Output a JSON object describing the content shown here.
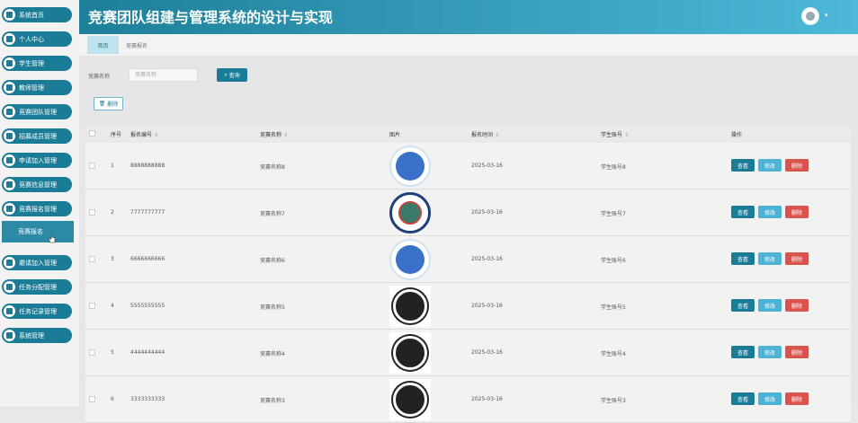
{
  "app": {
    "title": "竞赛团队组建与管理系统的设计与实现"
  },
  "sidebar": {
    "items": [
      {
        "label": "系统首页",
        "icon": "home-icon"
      },
      {
        "label": "个人中心",
        "icon": "user-center-icon"
      },
      {
        "label": "学生管理",
        "icon": "rocket-icon"
      },
      {
        "label": "教师管理",
        "icon": "grid-icon"
      },
      {
        "label": "竞赛团队管理",
        "icon": "grid-icon"
      },
      {
        "label": "招募成员管理",
        "icon": "grid-icon"
      },
      {
        "label": "申请加入管理",
        "icon": "grid-icon"
      },
      {
        "label": "竞赛信息管理",
        "icon": "grid-icon"
      },
      {
        "label": "竞赛报名管理",
        "icon": "person-icon"
      },
      {
        "label": "邀请加入管理",
        "icon": "list-icon"
      },
      {
        "label": "任务分配管理",
        "icon": "grid-icon"
      },
      {
        "label": "任务记录管理",
        "icon": "grid-icon"
      },
      {
        "label": "系统管理",
        "icon": "gear-icon"
      }
    ],
    "sub_item": "竞赛报名"
  },
  "tabs": [
    {
      "label": "首页",
      "active": true
    },
    {
      "label": "竞赛报名",
      "active": false
    }
  ],
  "search": {
    "label": "竞赛名称",
    "placeholder": "竞赛名称",
    "button": "查询"
  },
  "toolbar": {
    "delete_label": "删除"
  },
  "table": {
    "columns": [
      "序号",
      "报名编号",
      "竞赛名称",
      "图片",
      "报名时间",
      "学生账号",
      "操作"
    ],
    "rows": [
      {
        "index": "1",
        "code": "8888888888",
        "name": "竞赛名称8",
        "image": "logo-blue",
        "time": "2025-03-16",
        "account": "学生账号8"
      },
      {
        "index": "2",
        "code": "7777777777",
        "name": "竞赛名称7",
        "image": "logo-seal",
        "time": "2025-03-16",
        "account": "学生账号7"
      },
      {
        "index": "3",
        "code": "6666666666",
        "name": "竞赛名称6",
        "image": "logo-blue",
        "time": "2025-03-16",
        "account": "学生账号6"
      },
      {
        "index": "4",
        "code": "5555555555",
        "name": "竞赛名称5",
        "image": "logo-sketch",
        "time": "2025-03-16",
        "account": "学生账号5"
      },
      {
        "index": "5",
        "code": "4444444444",
        "name": "竞赛名称4",
        "image": "logo-sketch",
        "time": "2025-03-16",
        "account": "学生账号4"
      },
      {
        "index": "6",
        "code": "3333333333",
        "name": "竞赛名称3",
        "image": "logo-sketch",
        "time": "2025-03-16",
        "account": "学生账号3"
      }
    ],
    "actions": {
      "view": "查看",
      "edit": "修改",
      "delete": "删除"
    }
  },
  "colors": {
    "primary": "#1b7c98",
    "header_gradient_end": "#4db8d8",
    "edit": "#4fb3d6",
    "delete": "#d9534f"
  }
}
